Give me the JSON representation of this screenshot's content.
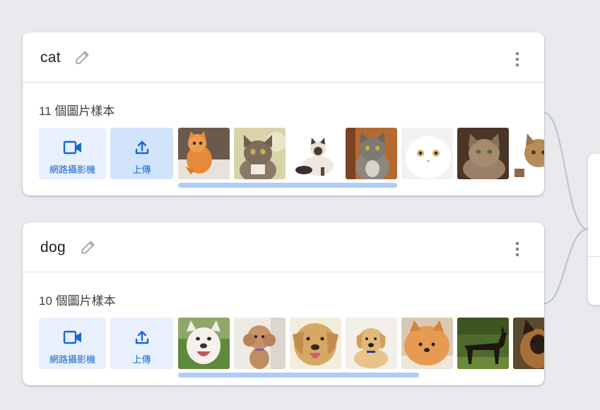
{
  "classes": [
    {
      "name": "cat",
      "sample_count": "11 個圖片樣本",
      "webcam_label": "網路攝影機",
      "upload_label": "上傳",
      "thumbnails": [
        {
          "alt": "orange kitten"
        },
        {
          "alt": "tabby cat"
        },
        {
          "alt": "himalayan cat"
        },
        {
          "alt": "maine coon cat"
        },
        {
          "alt": "white persian cat"
        },
        {
          "alt": "brown tabby cat"
        },
        {
          "alt": "tabby cat partial"
        }
      ]
    },
    {
      "name": "dog",
      "sample_count": "10 個圖片樣本",
      "webcam_label": "網路攝影機",
      "upload_label": "上傳",
      "thumbnails": [
        {
          "alt": "white pit bull"
        },
        {
          "alt": "poodle"
        },
        {
          "alt": "yellow labrador"
        },
        {
          "alt": "golden retriever puppy"
        },
        {
          "alt": "pomeranian"
        },
        {
          "alt": "doberman"
        },
        {
          "alt": "german shepherd partial"
        }
      ]
    }
  ],
  "icons": {
    "edit": "pencil-icon",
    "menu": "more-vert-icon",
    "webcam": "videocam-icon",
    "upload": "upload-icon"
  },
  "colors": {
    "accent": "#1967d2",
    "button_bg": "#e8f0fe",
    "button_bg_active": "#d2e3fc",
    "scrollbar": "#aecbfa",
    "background": "#e8eaed"
  }
}
